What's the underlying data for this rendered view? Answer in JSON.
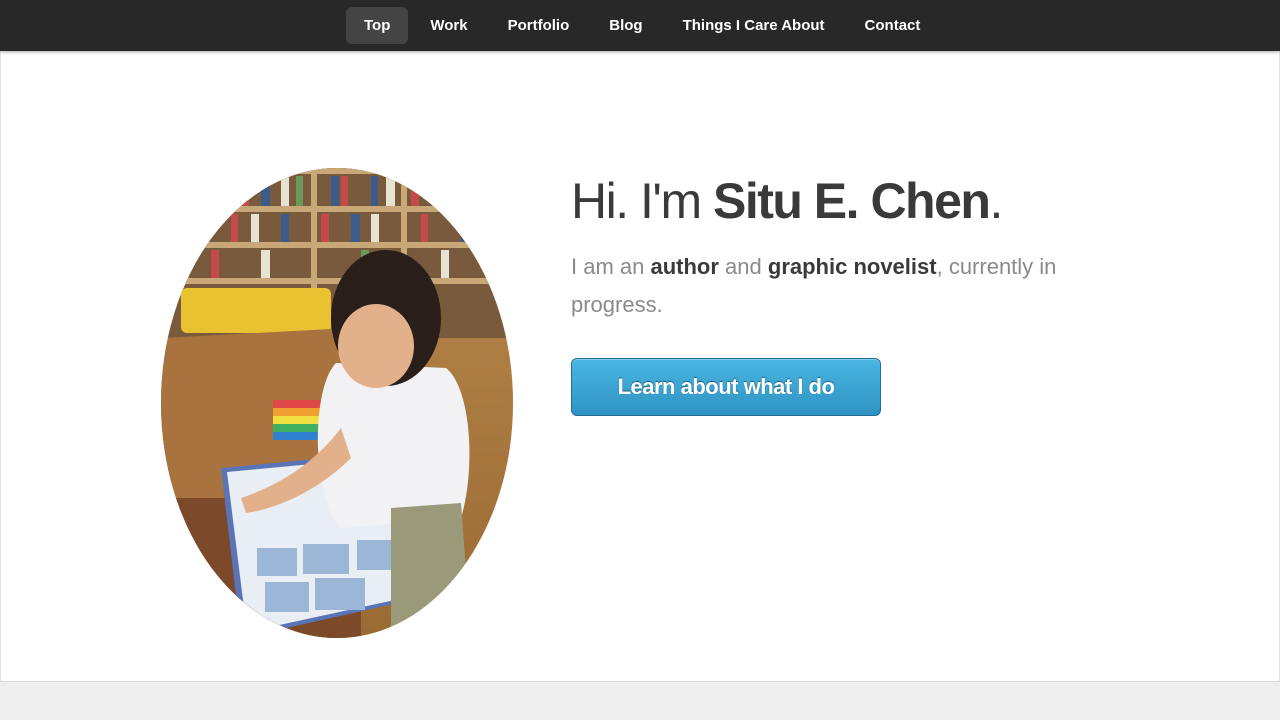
{
  "nav": {
    "items": [
      {
        "label": "Top",
        "active": true
      },
      {
        "label": "Work",
        "active": false
      },
      {
        "label": "Portfolio",
        "active": false
      },
      {
        "label": "Blog",
        "active": false
      },
      {
        "label": "Things I Care About",
        "active": false
      },
      {
        "label": "Contact",
        "active": false
      }
    ]
  },
  "hero": {
    "greeting": "Hi. I'm ",
    "name": "Situ E. Chen",
    "name_suffix": ".",
    "tagline_1": "I am an ",
    "tagline_author": "author",
    "tagline_2": " and ",
    "tagline_novelist": "graphic novelist",
    "tagline_3": ", currently in progress.",
    "cta_label": "Learn about what I do"
  },
  "colors": {
    "nav_bg": "#282828",
    "nav_active_bg": "#444444",
    "cta_top": "#4ab6e2",
    "cta_bottom": "#2f93c2",
    "heading_text": "#3a3a3a",
    "muted_text": "#8a8a8a"
  },
  "icons": {
    "portrait": "portrait-photo"
  }
}
